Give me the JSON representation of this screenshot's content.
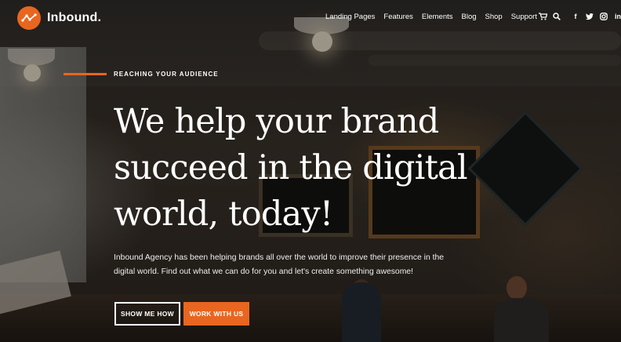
{
  "brand": {
    "name": "Inbound.",
    "accent_color": "#e8661f"
  },
  "nav": {
    "items": [
      "Landing Pages",
      "Features",
      "Elements",
      "Blog",
      "Shop",
      "Support"
    ]
  },
  "tools": {
    "icons": [
      "cart-icon",
      "search-icon",
      "facebook-icon",
      "twitter-icon",
      "instagram-icon",
      "linkedin-icon"
    ],
    "facebook_label": "f",
    "linkedin_label": "in"
  },
  "hero": {
    "eyebrow": "REACHING YOUR AUDIENCE",
    "headline_line1": "We help your brand",
    "headline_line2": "succeed in the digital",
    "headline_line3": "world, today!",
    "intro_line1": "Inbound Agency has been helping brands all over the world to improve their presence in the",
    "intro_line2": "digital world. Find out what we can do for you and let's create something awesome!",
    "primary_button": "SHOW ME HOW",
    "secondary_button": "WORK WITH US"
  }
}
